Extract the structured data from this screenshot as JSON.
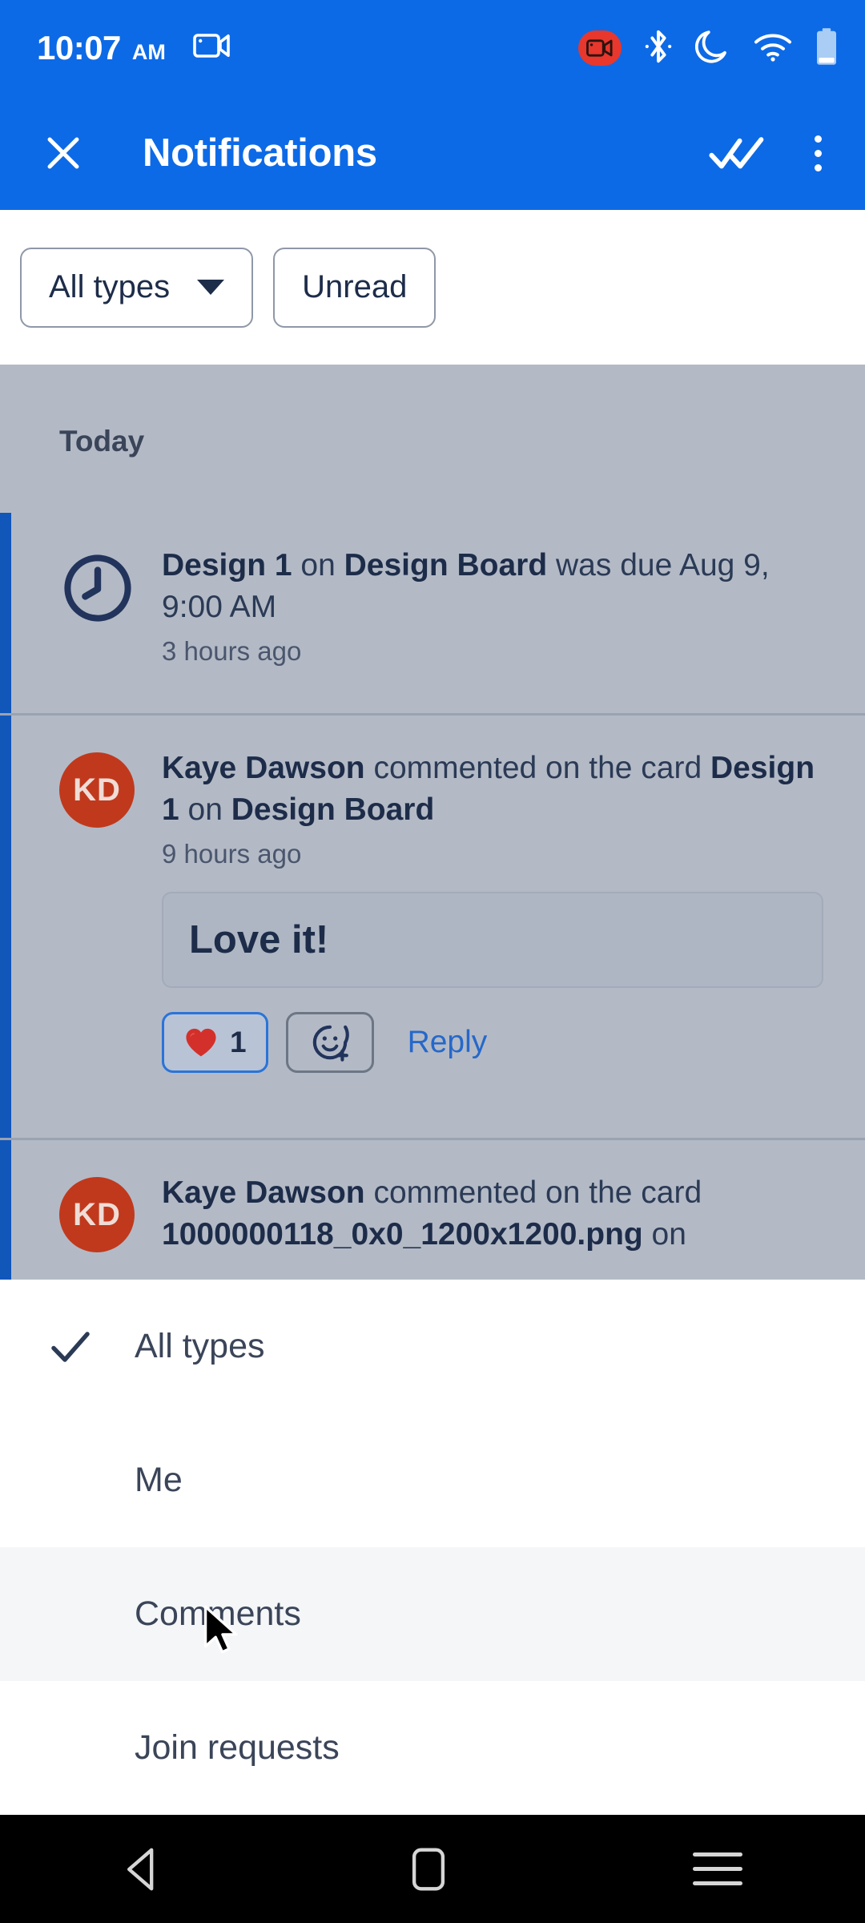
{
  "status_bar": {
    "time": "10:07",
    "ampm": "AM",
    "icons": [
      "screen-cast-icon",
      "screen-record-icon",
      "bluetooth-icon",
      "do-not-disturb-icon",
      "wifi-icon",
      "battery-icon"
    ],
    "accent_color": "#0d6ae6",
    "record_badge_color": "#e8372c"
  },
  "app_bar": {
    "close_label": "close-icon",
    "title": "Notifications",
    "mark_all_read_label": "mark-all-read-icon",
    "overflow_label": "overflow-menu-icon",
    "background": "#0d6ae6"
  },
  "filter_bar": {
    "type_chip": {
      "label": "All types",
      "has_caret": true
    },
    "unread_chip": {
      "label": "Unread"
    }
  },
  "notification_list": {
    "section_header": "Today",
    "items": [
      {
        "icon": "clock-icon",
        "text_parts": [
          {
            "t": "Design 1",
            "b": true
          },
          {
            "t": " on ",
            "b": false
          },
          {
            "t": "Design Board",
            "b": true
          },
          {
            "t": " was due Aug 9, 9:00 AM",
            "b": false
          }
        ],
        "time": "3 hours ago",
        "unread": true
      },
      {
        "avatar_initials": "KD",
        "avatar_color": "#c0391d",
        "text_parts": [
          {
            "t": "Kaye Dawson",
            "b": true
          },
          {
            "t": " commented on the card ",
            "b": false
          },
          {
            "t": "Design 1",
            "b": true
          },
          {
            "t": " on ",
            "b": false
          },
          {
            "t": "Design Board",
            "b": true
          }
        ],
        "time": "9 hours ago",
        "unread": true,
        "comment": "Love it!",
        "reactions": {
          "heart_count": "1",
          "heart_emoji": "❤",
          "add_reaction_label": "add-reaction-icon",
          "reply_label": "Reply"
        }
      },
      {
        "avatar_initials": "KD",
        "avatar_color": "#c0391d",
        "text_parts": [
          {
            "t": "Kaye Dawson",
            "b": true
          },
          {
            "t": " commented on the card ",
            "b": false
          },
          {
            "t": "1000000118_0x0_1200x1200.png",
            "b": true
          },
          {
            "t": " on",
            "b": false
          }
        ],
        "unread": true
      }
    ]
  },
  "bottom_sheet": {
    "options": [
      {
        "label": "All types",
        "selected": true,
        "hovered": false
      },
      {
        "label": "Me",
        "selected": false,
        "hovered": false
      },
      {
        "label": "Comments",
        "selected": false,
        "hovered": true
      },
      {
        "label": "Join requests",
        "selected": false,
        "hovered": false
      }
    ]
  },
  "nav_bar": {
    "back_label": "back-icon",
    "home_label": "home-icon",
    "recents_label": "recents-icon"
  }
}
